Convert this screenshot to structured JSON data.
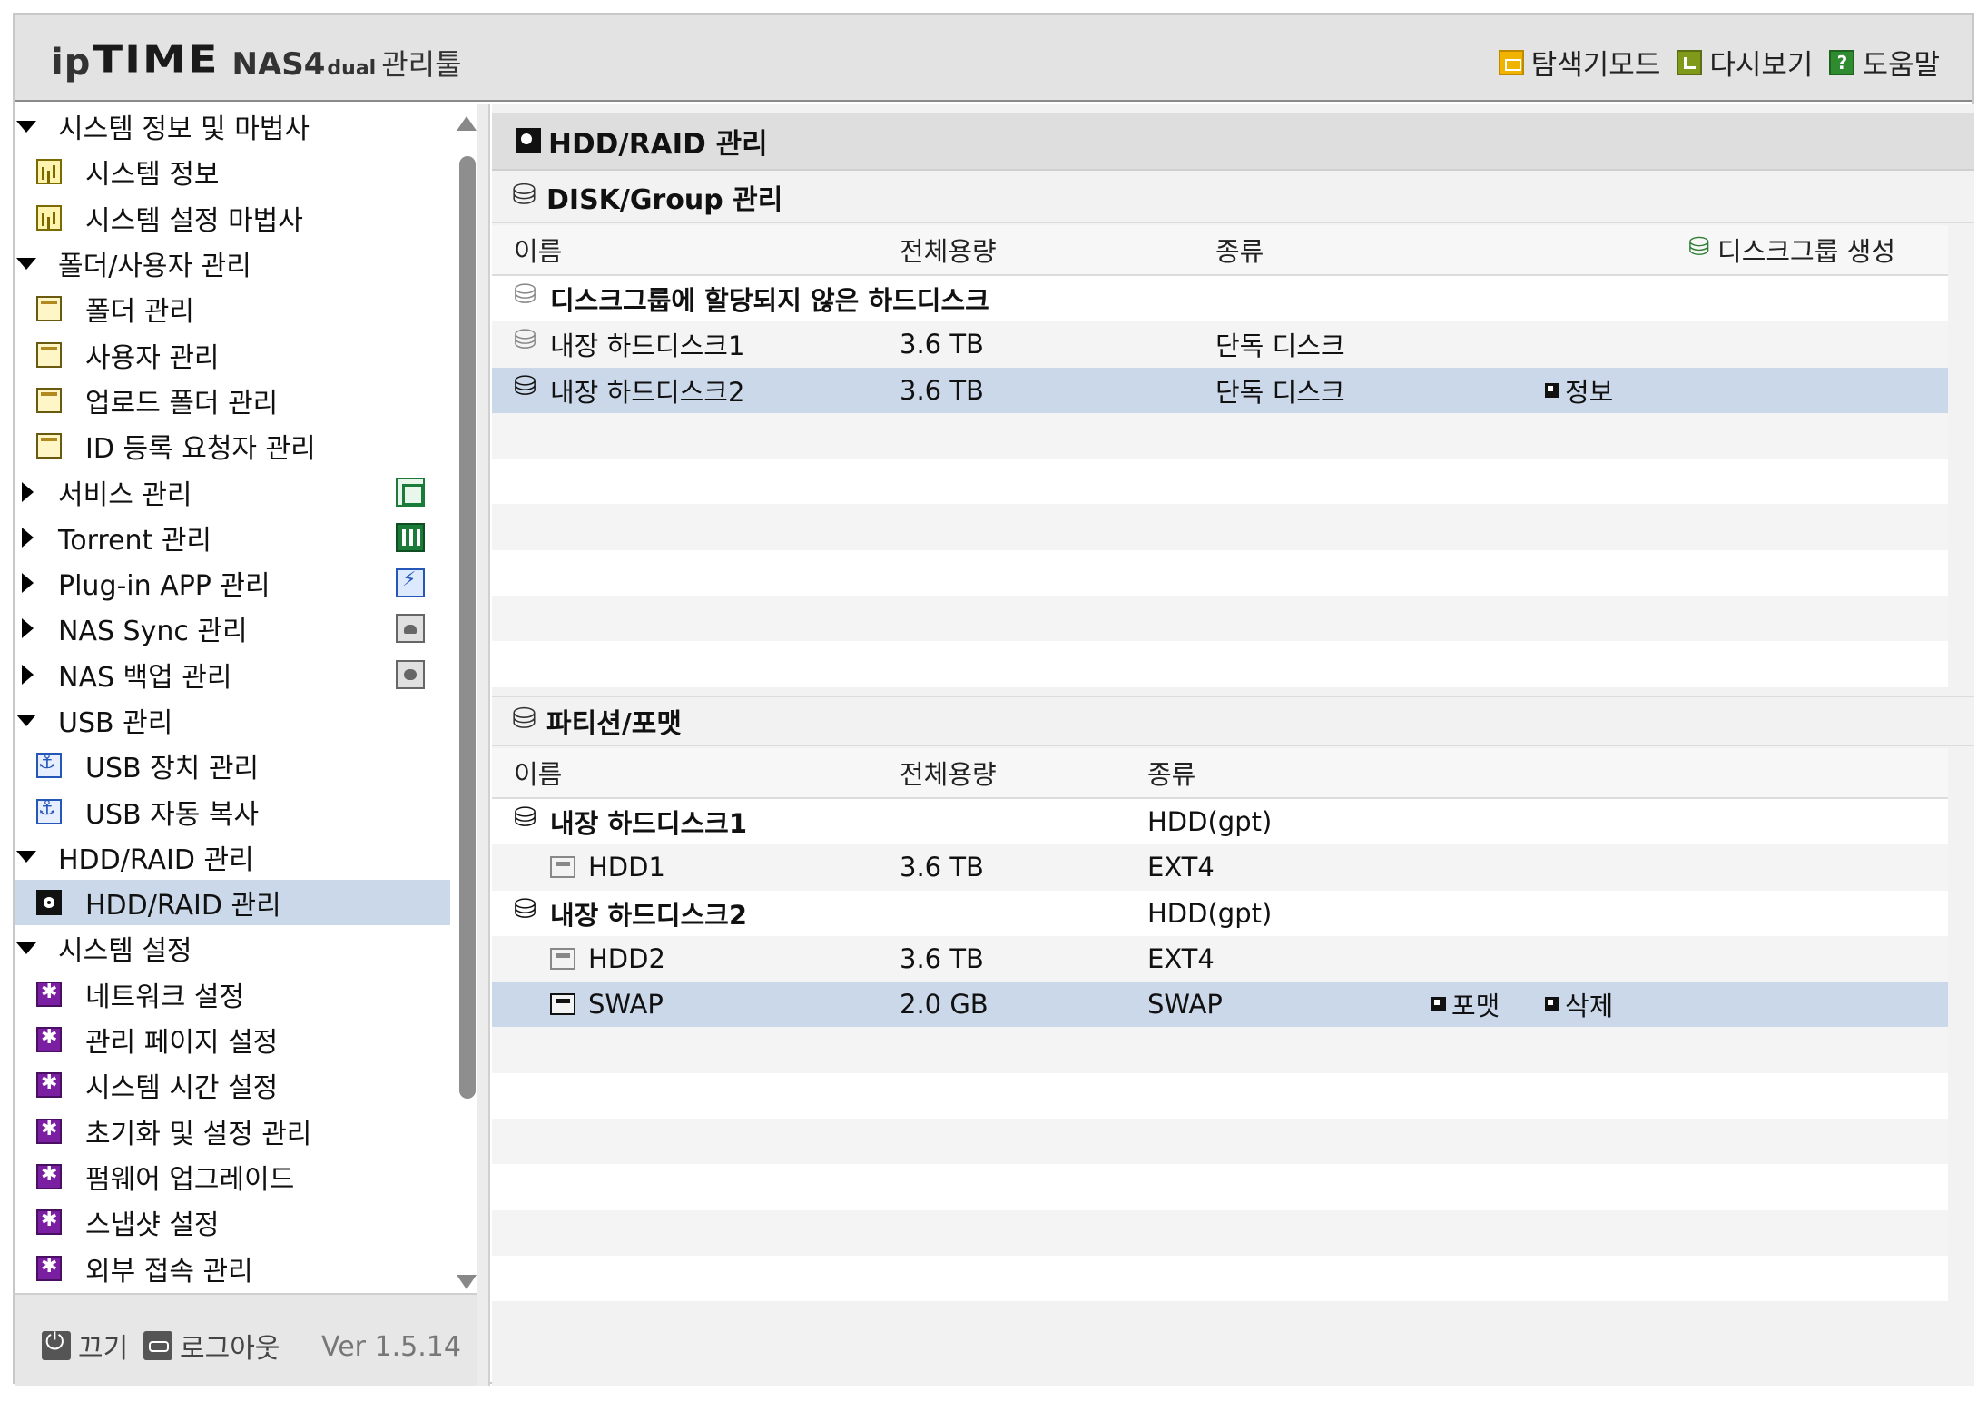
{
  "header": {
    "logo_ip": "ip",
    "logo_time": "TIME",
    "logo_nas": "NAS4",
    "logo_dual": "dual",
    "logo_tool": "관리툴",
    "links": [
      {
        "label": "탐색기모드",
        "icon": "explorer-icon"
      },
      {
        "label": "다시보기",
        "icon": "refresh-icon"
      },
      {
        "label": "도움말",
        "icon": "help-icon"
      }
    ]
  },
  "sidebar": {
    "items": [
      {
        "label": "시스템 정보 및 마법사",
        "type": "group",
        "expanded": true
      },
      {
        "label": "시스템 정보",
        "type": "leaf",
        "icon": "chart-icon"
      },
      {
        "label": "시스템 설정 마법사",
        "type": "leaf",
        "icon": "chart-icon"
      },
      {
        "label": "폴더/사용자 관리",
        "type": "group",
        "expanded": true
      },
      {
        "label": "폴더 관리",
        "type": "leaf",
        "icon": "folder-icon"
      },
      {
        "label": "사용자 관리",
        "type": "leaf",
        "icon": "folder-icon"
      },
      {
        "label": "업로드 폴더 관리",
        "type": "leaf",
        "icon": "folder-icon"
      },
      {
        "label": "ID 등록 요청자 관리",
        "type": "leaf",
        "icon": "folder-icon"
      },
      {
        "label": "서비스 관리",
        "type": "group",
        "expanded": false,
        "right_icon": "service-icon"
      },
      {
        "label": "Torrent 관리",
        "type": "group",
        "expanded": false,
        "right_icon": "torrent-icon"
      },
      {
        "label": "Plug-in APP 관리",
        "type": "group",
        "expanded": false,
        "right_icon": "plugin-icon"
      },
      {
        "label": "NAS Sync 관리",
        "type": "group",
        "expanded": false,
        "right_icon": "sync-icon"
      },
      {
        "label": "NAS 백업 관리",
        "type": "group",
        "expanded": false,
        "right_icon": "backup-icon"
      },
      {
        "label": "USB 관리",
        "type": "group",
        "expanded": true
      },
      {
        "label": "USB 장치 관리",
        "type": "leaf",
        "icon": "usb-icon"
      },
      {
        "label": "USB 자동 복사",
        "type": "leaf",
        "icon": "usb-icon"
      },
      {
        "label": "HDD/RAID 관리",
        "type": "group",
        "expanded": true
      },
      {
        "label": "HDD/RAID 관리",
        "type": "leaf",
        "icon": "hdd-icon",
        "selected": true
      },
      {
        "label": "시스템 설정",
        "type": "group",
        "expanded": true
      },
      {
        "label": "네트워크 설정",
        "type": "leaf",
        "icon": "gear-icon"
      },
      {
        "label": "관리 페이지 설정",
        "type": "leaf",
        "icon": "gear-icon"
      },
      {
        "label": "시스템 시간 설정",
        "type": "leaf",
        "icon": "gear-icon"
      },
      {
        "label": "초기화 및 설정 관리",
        "type": "leaf",
        "icon": "gear-icon"
      },
      {
        "label": "펌웨어 업그레이드",
        "type": "leaf",
        "icon": "gear-icon"
      },
      {
        "label": "스냅샷 설정",
        "type": "leaf",
        "icon": "gear-icon"
      },
      {
        "label": "외부 접속 관리",
        "type": "leaf",
        "icon": "gear-icon"
      }
    ],
    "footer": {
      "power_label": "끄기",
      "logout_label": "로그아웃",
      "version": "Ver 1.5.14"
    }
  },
  "main": {
    "title": "HDD/RAID 관리",
    "disk_group": {
      "title": "DISK/Group 관리",
      "headers": {
        "name": "이름",
        "capacity": "전체용량",
        "type": "종류"
      },
      "create_label": "디스크그룹 생성",
      "rows": [
        {
          "name": "디스크그룹에 할당되지 않은 하드디스크",
          "capacity": "",
          "type": "",
          "kind": "group-header"
        },
        {
          "name": "내장 하드디스크1",
          "capacity": "3.6 TB",
          "type": "단독 디스크",
          "kind": "disk"
        },
        {
          "name": "내장 하드디스크2",
          "capacity": "3.6 TB",
          "type": "단독 디스크",
          "kind": "disk",
          "selected": true,
          "action": "정보"
        }
      ]
    },
    "partition": {
      "title": "파티션/포맷",
      "headers": {
        "name": "이름",
        "capacity": "전체용량",
        "type": "종류"
      },
      "rows": [
        {
          "name": "내장 하드디스크1",
          "capacity": "",
          "type": "HDD(gpt)",
          "kind": "disk"
        },
        {
          "name": "HDD1",
          "capacity": "3.6 TB",
          "type": "EXT4",
          "kind": "partition"
        },
        {
          "name": "내장 하드디스크2",
          "capacity": "",
          "type": "HDD(gpt)",
          "kind": "disk"
        },
        {
          "name": "HDD2",
          "capacity": "3.6 TB",
          "type": "EXT4",
          "kind": "partition"
        },
        {
          "name": "SWAP",
          "capacity": "2.0 GB",
          "type": "SWAP",
          "kind": "partition",
          "selected": true,
          "format_label": "포맷",
          "delete_label": "삭제"
        }
      ]
    }
  }
}
